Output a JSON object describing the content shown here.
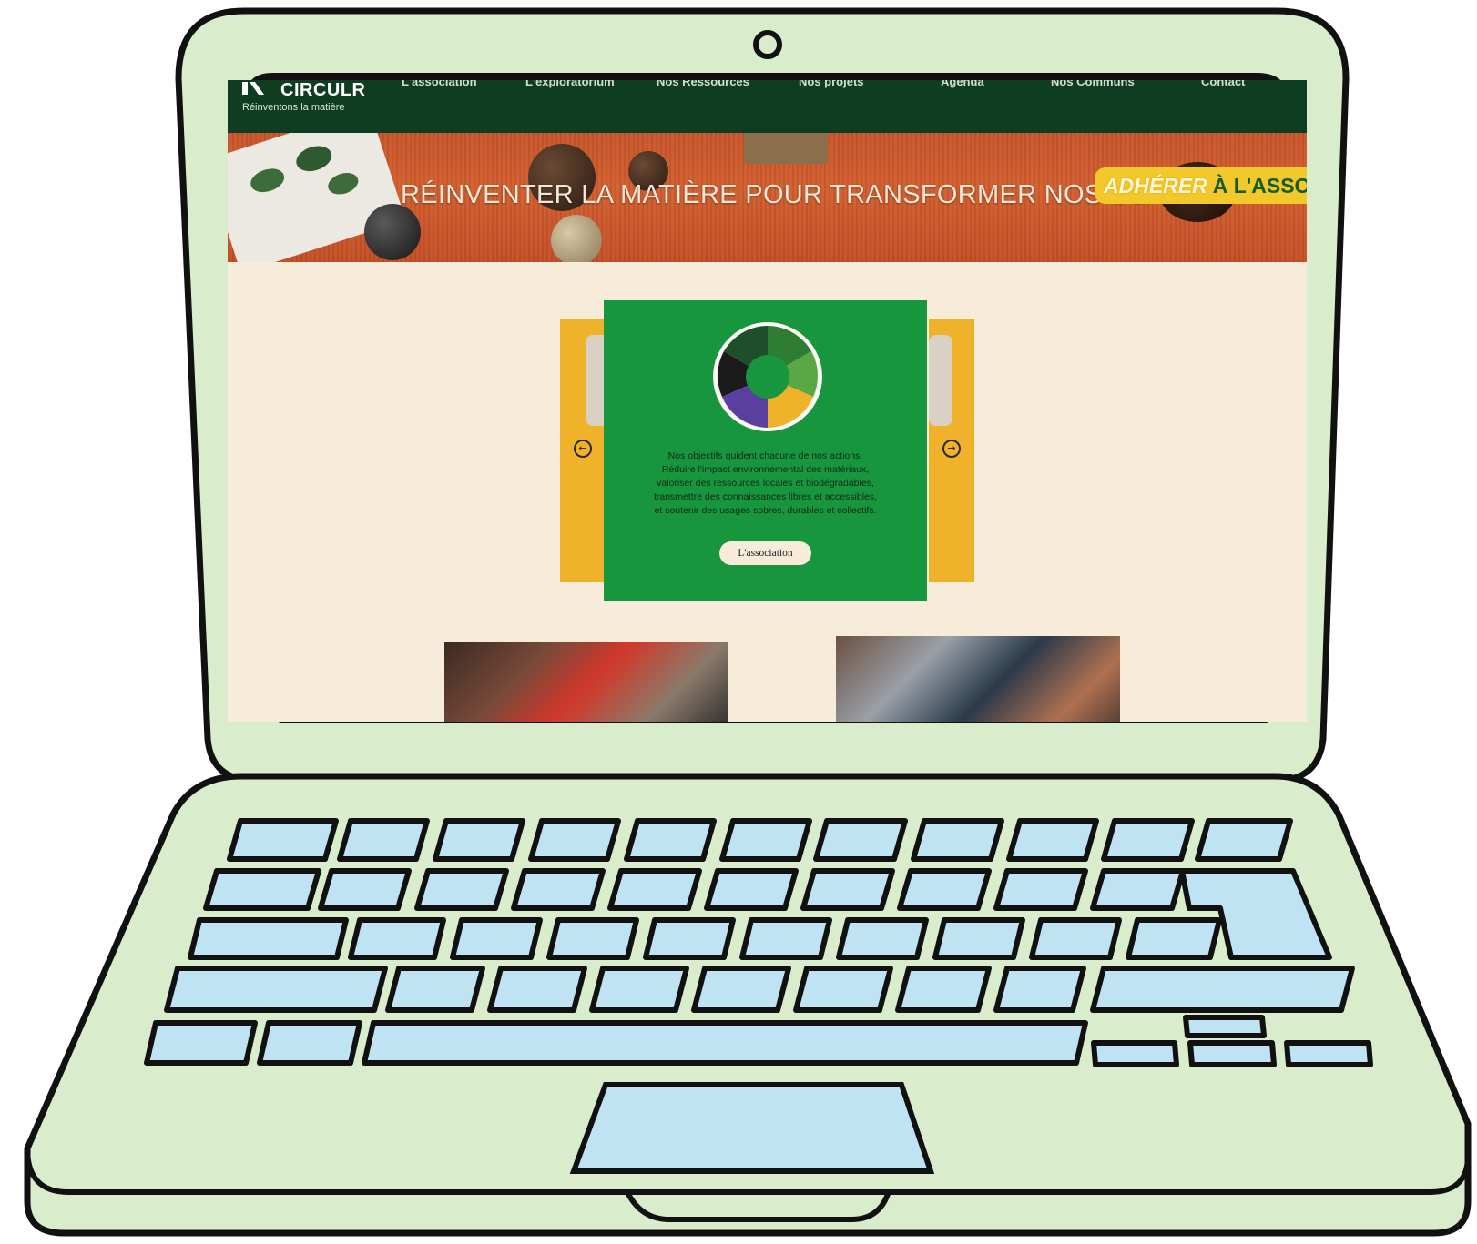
{
  "site": {
    "logo_name": "CIRCULR",
    "tagline": "Réinventons la matière"
  },
  "nav": {
    "items": [
      {
        "label": "L'association"
      },
      {
        "label": "L'exploratorium"
      },
      {
        "label": "Nos Ressources"
      },
      {
        "label": "Nos projets"
      },
      {
        "label": "Agenda"
      },
      {
        "label": "Nos Communs"
      },
      {
        "label": "Contact"
      }
    ]
  },
  "banner": {
    "title": "RÉINVENTER LA MATIÈRE POUR TRANSFORMER NOS USAGES",
    "cta_part1": "ADHÉRER",
    "cta_part2": "À L'ASSO"
  },
  "carousel": {
    "text": "Nos objectifs guident chacune de nos actions.\nRéduire l'impact environnemental des matériaux,\nvaloriser des ressources locales et biodégradables,\ntransmettre des connaissances libres et accessibles,\net soutenir des usages sobres, durables et collectifs.",
    "button_label": "L'association",
    "prev_icon": "arrow-left-circle-icon",
    "next_icon": "arrow-right-circle-icon"
  },
  "colors": {
    "nav_bg": "#0f3d22",
    "banner_orange": "#c8552a",
    "cta_yellow": "#f2c82a",
    "card_green": "#17963d",
    "side_yellow": "#f0b22a",
    "page_bg": "#f6ecd9",
    "laptop_body": "#d9eccb",
    "key_fill": "#bfe3f3"
  }
}
